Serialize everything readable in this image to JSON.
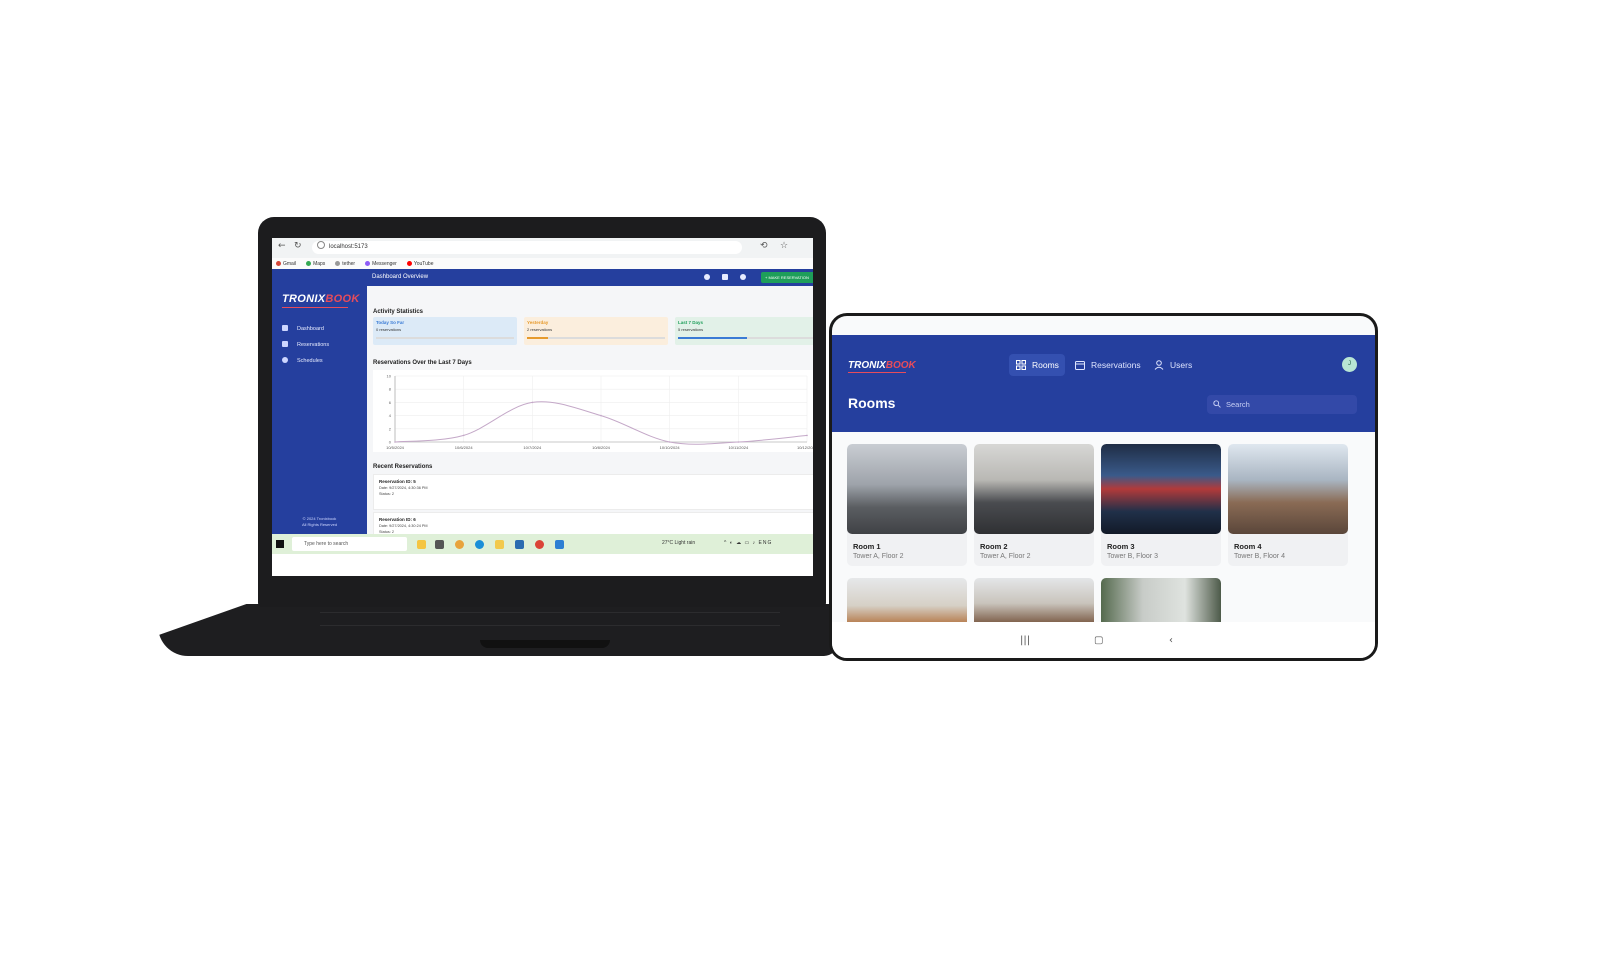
{
  "laptop": {
    "browser": {
      "url": "localhost:5173",
      "bookmarks": [
        "Gmail",
        "Maps",
        "tether",
        "Messenger",
        "YouTube"
      ]
    },
    "app": {
      "logo": {
        "part1": "TRONIX",
        "part2": "BOOK"
      },
      "sidebar": {
        "items": [
          {
            "label": "Dashboard",
            "icon": "grid-icon"
          },
          {
            "label": "Reservations",
            "icon": "calendar-icon"
          },
          {
            "label": "Schedules",
            "icon": "clock-icon"
          }
        ],
        "footer_line1": "© 2024 Tronixbook",
        "footer_line2": "All Rights Reserved"
      },
      "header": {
        "title": "Dashboard Overview",
        "button_label": "+ MAKE RESERVATION"
      },
      "activity_title": "Activity Statistics",
      "stats": [
        {
          "label": "Today So Far",
          "value": "0 reservations",
          "color": "#3a7bd5",
          "bg": "#dceaf7",
          "progress": 0.0
        },
        {
          "label": "Yesterday",
          "value": "2 reservations",
          "color": "#e69a2c",
          "bg": "#fbeedd",
          "progress": 0.15
        },
        {
          "label": "Last 7 Days",
          "value": "5 reservations",
          "color": "#1e9e5a",
          "bg": "#e2f1e8",
          "progress": 0.5
        }
      ],
      "chart_title": "Reservations Over the Last 7 Days",
      "chart_data": {
        "type": "line",
        "x": [
          "10/5/2024",
          "10/6/2024",
          "10/7/2024",
          "10/8/2024",
          "10/10/2024",
          "10/11/2024",
          "10/12/2024"
        ],
        "values": [
          0,
          1,
          6,
          4,
          0,
          0,
          1
        ],
        "ylim": [
          0,
          10
        ],
        "yticks": [
          "10",
          "8",
          "6",
          "4",
          "2",
          "0"
        ],
        "title": "Reservations Over the Last 7 Days",
        "grid": true
      },
      "recent_title": "Recent Reservations",
      "recent": [
        {
          "id": "Reservation ID: 5",
          "date": "Date: 9/27/2024, 4:30:36 PM",
          "status": "Status: 2"
        },
        {
          "id": "Reservation ID: 6",
          "date": "Date: 9/27/2024, 4:30:24 PM",
          "status": "Status: 2"
        }
      ]
    },
    "taskbar": {
      "search_placeholder": "Type here to search",
      "weather": "27°C Light rain",
      "tray": "ENG"
    }
  },
  "tablet": {
    "logo": {
      "part1": "TRONIX",
      "part2": "BOOK"
    },
    "nav": [
      {
        "label": "Rooms",
        "icon": "grid-icon",
        "active": true
      },
      {
        "label": "Reservations",
        "icon": "calendar-icon",
        "active": false
      },
      {
        "label": "Users",
        "icon": "user-icon",
        "active": false
      }
    ],
    "avatar_initial": "J",
    "page_title": "Rooms",
    "search_placeholder": "Search",
    "rooms": [
      {
        "name": "Room 1",
        "location": "Tower A, Floor 2"
      },
      {
        "name": "Room 2",
        "location": "Tower A, Floor 2"
      },
      {
        "name": "Room 3",
        "location": "Tower B, Floor 3"
      },
      {
        "name": "Room 4",
        "location": "Tower B, Floor 4"
      }
    ]
  }
}
